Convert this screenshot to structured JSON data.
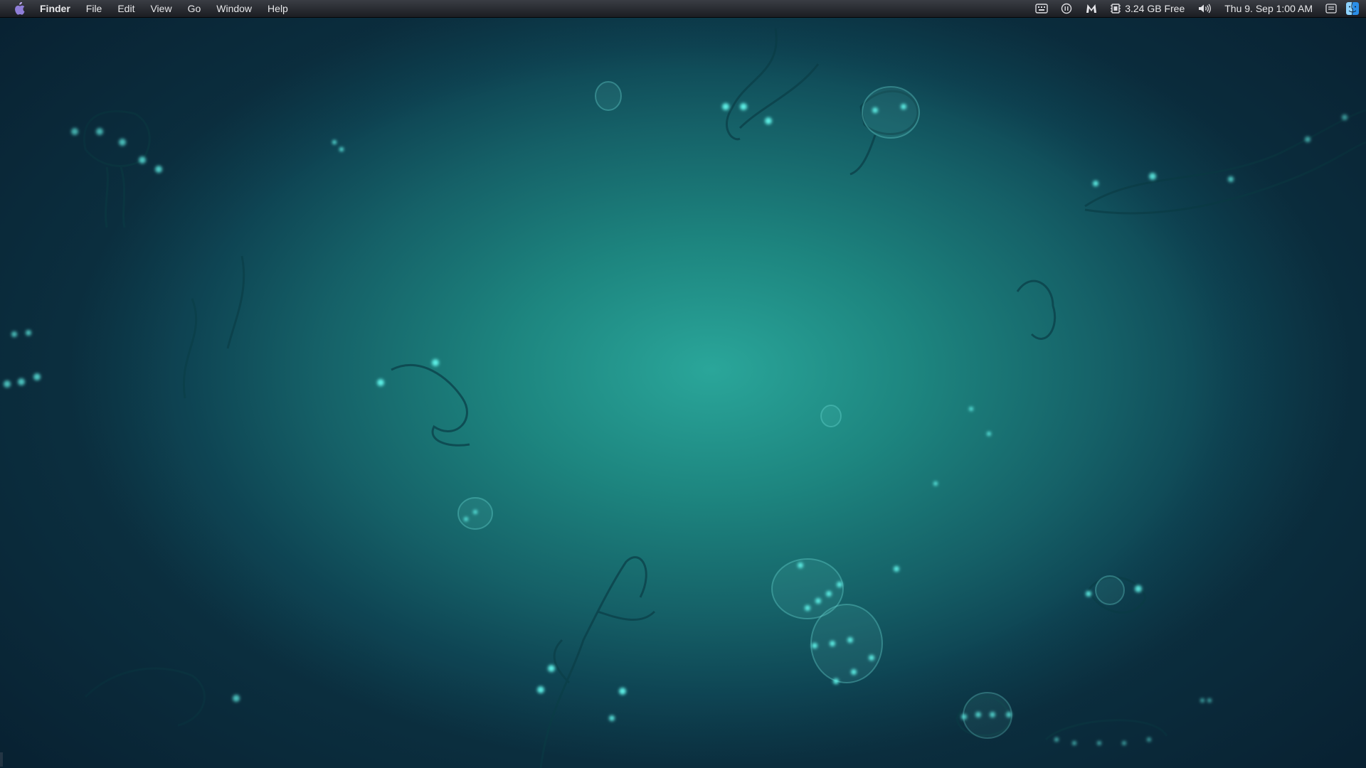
{
  "menubar": {
    "app_name": "Finder",
    "menus": [
      "File",
      "Edit",
      "View",
      "Go",
      "Window",
      "Help"
    ],
    "status": {
      "memory_free": "3.24 GB Free",
      "datetime": "Thu 9. Sep  1:00 AM"
    },
    "icons": [
      "apple-logo-icon",
      "keyboard-icon",
      "sync-icon",
      "mail-m-icon",
      "memory-chip-icon",
      "volume-icon",
      "notification-center-icon",
      "finder-icon"
    ]
  },
  "colors": {
    "menubar_top": "#3a3d44",
    "menubar_bottom": "#1b1d22",
    "sea_center": "#2aa69a",
    "sea_edge": "#0c3343",
    "glow": "#5ff0e6"
  }
}
